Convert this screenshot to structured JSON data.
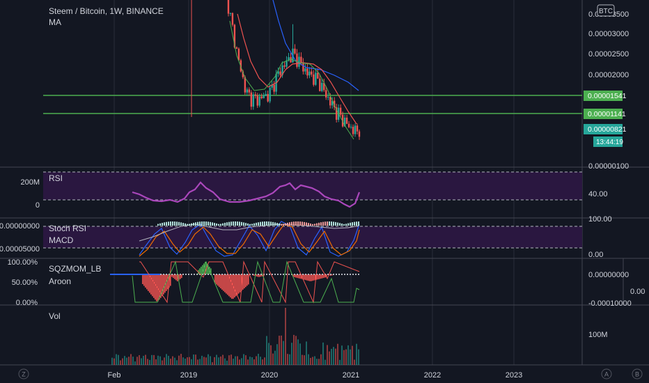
{
  "colors": {
    "background": "#131722",
    "grid": "#2a2e39",
    "up": "#26a69a",
    "down": "#ef5350",
    "hline": "#4caf50",
    "ma_fast": "#ef5350",
    "ma_mid": "#4caf50",
    "ma_slow": "#2962ff",
    "rsi": "#ab47bc",
    "band": "#2a1740",
    "text": "#d1d4dc",
    "price_label_green": "#4caf50",
    "price_label_teal": "#26a69a"
  },
  "header": {
    "symbol_line": "Steem / Bitcoin, 1W, BINANCE",
    "indicator_ma": "MA",
    "currency_badge": "BTC"
  },
  "panes": {
    "rsi": {
      "title": "RSI",
      "left_labels": [
        "200M",
        "0"
      ],
      "right_label": "40.00"
    },
    "stoch_macd": {
      "title1": "Stoch RSI",
      "title2": "MACD",
      "left_labels": [
        "0.00000000",
        "-0.00005000"
      ],
      "right_labels": [
        "100.00",
        "0.00"
      ]
    },
    "sqz_aroon": {
      "title1": "SQZMOM_LB",
      "title2": "Aroon",
      "left_labels": [
        "100.00%",
        "50.00%",
        "0.00%"
      ],
      "right_labels": [
        "0.00000000",
        "-0.00010000"
      ],
      "far_right_label": "0.00"
    },
    "volume": {
      "title": "Vol",
      "right_label": "100M"
    }
  },
  "price_axis": {
    "ticks": [
      "0.00003500",
      "0.00003000",
      "0.00002500",
      "0.00002000",
      "0.00000100"
    ],
    "badges": [
      "0.00001541",
      "0.00001141",
      "0.00000821",
      "13:44:19"
    ]
  },
  "time_axis": {
    "labels": [
      "Feb",
      "2019",
      "2020",
      "2021",
      "2022",
      "2023"
    ]
  },
  "footer": {
    "left_button": "Z",
    "auto_button": "A",
    "scale_button": "B"
  },
  "chart_data": {
    "type": "line",
    "title": "Steem / Bitcoin, 1W, BINANCE",
    "series": [
      {
        "name": "Steem / Bitcoin",
        "values": [
          4.3e-05,
          3.5e-05,
          2.8e-05,
          2.2e-05,
          1.72e-05,
          1.6e-05,
          1.58e-05,
          1.65e-05,
          1.7e-05,
          2e-05,
          2.25e-05,
          2.4e-05,
          2.62e-05,
          2.5e-05,
          2.3e-05,
          2.15e-05,
          2.08e-05,
          1.95e-05,
          1.7e-05,
          1.5e-05,
          1.3e-05,
          1.15e-05,
          1e-05,
          9e-06,
          8.2e-06
        ]
      }
    ],
    "horizontal_levels": [
      1.541e-05,
      1.141e-05
    ],
    "last_price": 8.21e-06,
    "countdown": "13:44:19",
    "rsi_level": 40.0
  }
}
